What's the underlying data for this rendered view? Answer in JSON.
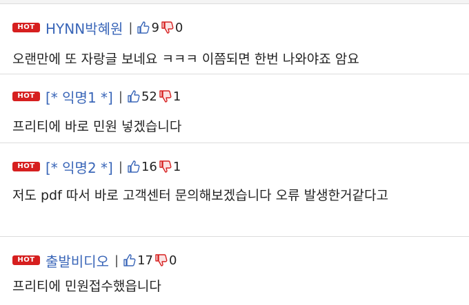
{
  "hot_label": "HOT",
  "comments": [
    {
      "author": "HYNN박혜원",
      "likes": "9",
      "dislikes": "0",
      "text": "오랜만에 또 자랑글 보네요 ㅋㅋㅋ 이쯤되면 한번 나와야죠 암요"
    },
    {
      "author": "[* 익명1 *]",
      "likes": "52",
      "dislikes": "1",
      "text": "프리티에 바로 민원 넣겠습니다"
    },
    {
      "author": "[* 익명2 *]",
      "likes": "16",
      "dislikes": "1",
      "text": "저도 pdf 따서 바로 고객센터 문의해보겠습니다 오류 발생한거같다고"
    },
    {
      "author": "출발비디오",
      "likes": "17",
      "dislikes": "0",
      "text": "프리티에 민원접수했읍니다"
    }
  ],
  "colors": {
    "hot_badge": "#d61f1f",
    "author": "#3a66b8",
    "like_icon": "#3a66b8",
    "dislike_icon": "#d61f1f"
  },
  "separator": "|"
}
